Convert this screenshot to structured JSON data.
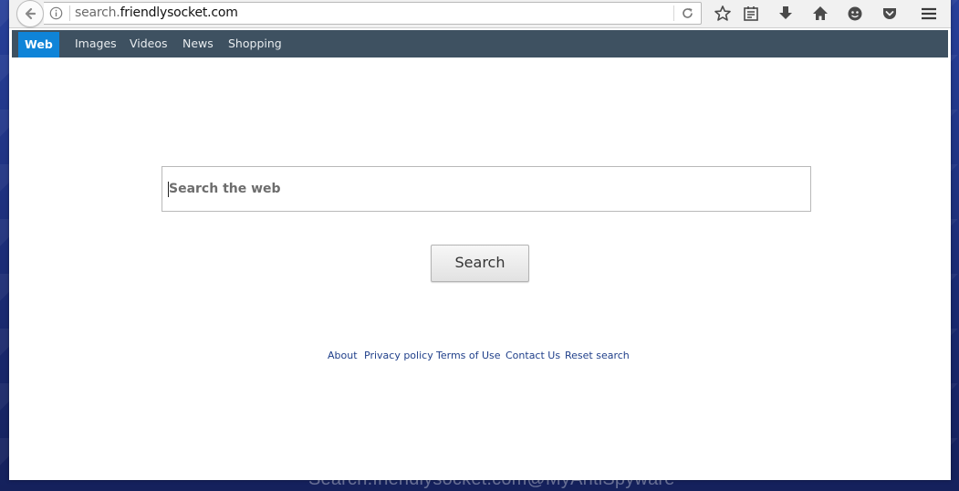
{
  "browser": {
    "url_prefix": "search.",
    "url_host": "friendlysocket.com"
  },
  "site_nav": {
    "items": [
      {
        "label": "Web",
        "active": true
      },
      {
        "label": "Images",
        "active": false
      },
      {
        "label": "Videos",
        "active": false
      },
      {
        "label": "News",
        "active": false
      },
      {
        "label": "Shopping",
        "active": false
      }
    ]
  },
  "search": {
    "placeholder": "Search the web",
    "button_label": "Search"
  },
  "footer": {
    "links": [
      "About",
      "Privacy policy",
      "Terms of Use",
      "Contact Us",
      "Reset search"
    ]
  },
  "watermark": "Search.friendlysocket.com@MyAntiSpyware",
  "colors": {
    "nav_bg": "#3e5161",
    "nav_active": "#0f84d8",
    "link": "#1f3f8a",
    "desktop": "#1d2f7a"
  },
  "icons": {
    "toolbar": [
      "bookmark-star-icon",
      "reading-list-icon",
      "download-icon",
      "home-icon",
      "chat-icon",
      "pocket-icon",
      "menu-icon"
    ]
  }
}
